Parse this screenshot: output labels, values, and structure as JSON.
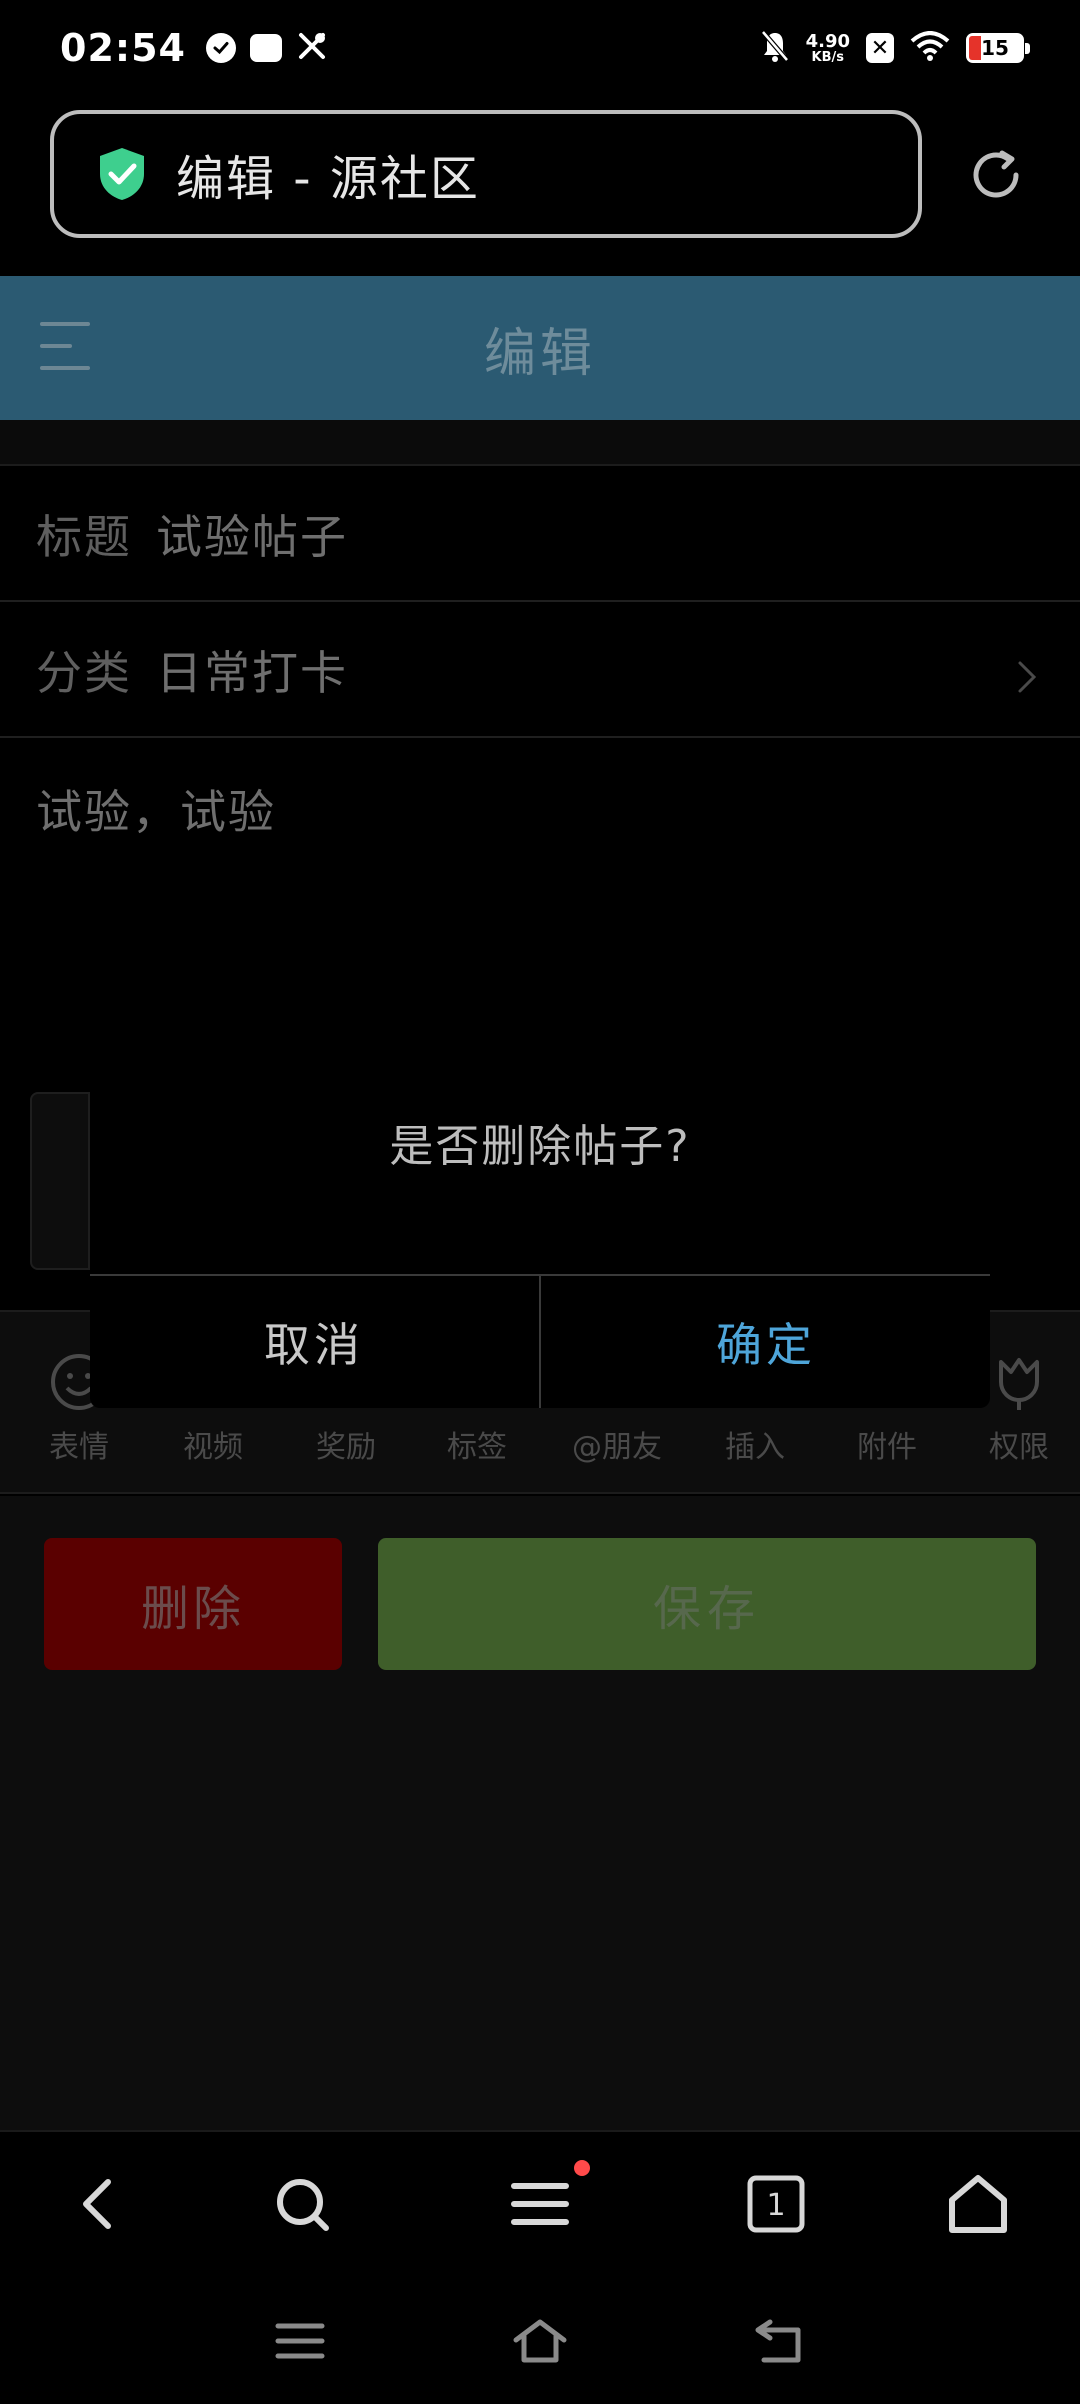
{
  "status_bar": {
    "time": "02:54",
    "net_speed_value": "4.90",
    "net_speed_unit": "KB/s",
    "battery_level": "15",
    "icons": [
      "check-circle-icon",
      "vivo-icon",
      "tools-icon",
      "mute-bell-icon",
      "close-box-icon",
      "wifi-icon",
      "battery-icon"
    ]
  },
  "address_bar": {
    "text": "编辑 - 源社区",
    "shield_color": "#3ecf8e"
  },
  "header": {
    "title": "编辑",
    "color": "#2b5a72"
  },
  "form": {
    "title_label": "标题",
    "title_value": "试验帖子",
    "category_label": "分类",
    "category_value": "日常打卡",
    "content": "试验，试验"
  },
  "toolbar": {
    "items": [
      {
        "label": "表情",
        "icon": "emoji-icon"
      },
      {
        "label": "视频",
        "icon": "video-icon"
      },
      {
        "label": "奖励",
        "icon": "reward-icon"
      },
      {
        "label": "标签",
        "icon": "tag-icon"
      },
      {
        "label": "@朋友",
        "icon": "mention-icon"
      },
      {
        "label": "插入",
        "icon": "insert-icon"
      },
      {
        "label": "附件",
        "icon": "attachment-icon"
      },
      {
        "label": "权限",
        "icon": "tulip-icon"
      }
    ]
  },
  "actions": {
    "delete_label": "删除",
    "save_label": "保存",
    "delete_color": "#5a0000",
    "save_color": "#3f5e2a"
  },
  "dialog": {
    "message": "是否删除帖子?",
    "cancel_label": "取消",
    "confirm_label": "确定",
    "confirm_color": "#4ea5d9"
  },
  "browser_nav": {
    "tab_count": "1",
    "icons": [
      "back-icon",
      "search-icon",
      "menu-icon",
      "tabs-icon",
      "home-icon"
    ]
  },
  "system_nav": {
    "icons": [
      "recents-icon",
      "home-icon",
      "back-icon"
    ]
  }
}
